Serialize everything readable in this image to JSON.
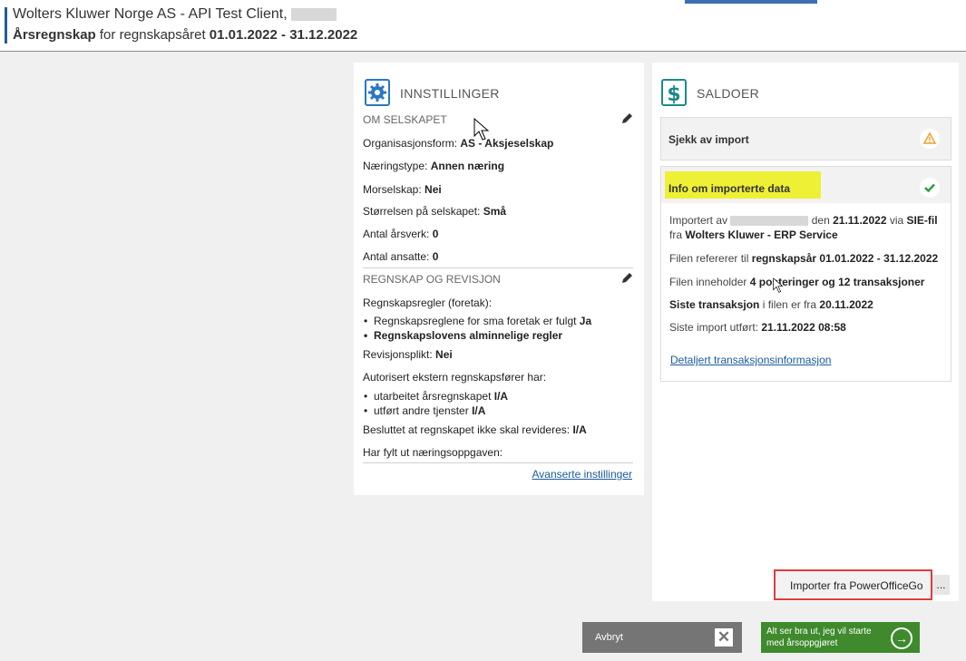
{
  "header": {
    "client_title": "Wolters Kluwer Norge AS - API Test Client,",
    "report_title": "Årsregnskap",
    "period_prefix": "for regnskapsåret",
    "period": "01.01.2022 - 31.12.2022"
  },
  "settings": {
    "title": "INNSTILLINGER",
    "about_heading": "OM SELSKAPET",
    "org_form_label": "Organisasjonsform:",
    "org_form_value": "AS - Aksjeselskap",
    "industry_label": "Næringstype:",
    "industry_value": "Annen næring",
    "parent_label": "Morselskap:",
    "parent_value": "Nei",
    "size_label": "Størrelsen på selskapet:",
    "size_value": "Små",
    "fte_label": "Antal årsverk:",
    "fte_value": "0",
    "employees_label": "Antal ansatte:",
    "employees_value": "0",
    "accounting_heading": "REGNSKAP OG REVISJON",
    "rules_label": "Regnskapsregler (foretak):",
    "rule1_text": "Regnskapsreglene for sma foretak er fulgt",
    "rule1_value": "Ja",
    "rule2_text": "Regnskapslovens alminnelige regler",
    "audit_label": "Revisjonsplikt:",
    "audit_value": "Nei",
    "external_label": "Autorisert ekstern regnskapsfører har:",
    "ext1_text": "utarbeitet årsregnskapet",
    "ext1_value": "I/A",
    "ext2_text": "utført andre tjenster",
    "ext2_value": "I/A",
    "noaudit_label": "Besluttet at regnskapet ikke skal revideres:",
    "noaudit_value": "I/A",
    "tax_form_label": "Har fylt ut næringsoppgaven:",
    "advanced_link": "Avanserte instillinger"
  },
  "balances": {
    "title": "SALDOER",
    "check_import": "Sjekk av import",
    "info_title": "Info om importerte data",
    "imported_by_prefix": "Importert av",
    "imported_by_date_prefix": "den",
    "imported_date": "21.11.2022",
    "via_label": "via",
    "via_value": "SIE-fil",
    "from_label": "fra",
    "from_value": "Wolters Kluwer - ERP Service",
    "refers_label": "Filen refererer til",
    "refers_value": "regnskapsår 01.01.2022 - 31.12.2022",
    "contains_label": "Filen inneholder",
    "contains_value": "4 posteringer og 12 transaksjoner",
    "last_trans_label": "Siste transaksjon",
    "last_trans_mid": "i filen er fra",
    "last_trans_value": "20.11.2022",
    "last_import_label": "Siste import utført:",
    "last_import_value": "21.11.2022 08:58",
    "details_link": "Detaljert transaksjonsinformasjon"
  },
  "actions": {
    "import_button": "Importer fra PowerOfficeGo",
    "more_button": "...",
    "cancel_button": "Avbryt",
    "proceed_button": "Alt ser bra ut, jeg vil starte med årsoppgjøret"
  },
  "colors": {
    "accent": "#1f5c99",
    "highlight": "#eef035",
    "ok_green": "#2e9e3e",
    "warn_orange": "#f0a030",
    "go_green": "#3e8a2d",
    "cancel_gray": "#757575",
    "import_border": "#e03c3c"
  }
}
